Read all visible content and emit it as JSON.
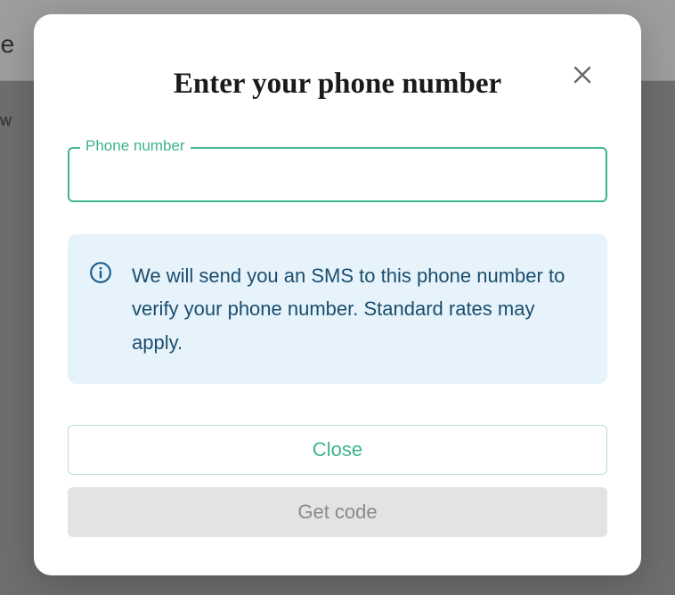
{
  "backdrop": {
    "text1": "ne",
    "text2": "tw"
  },
  "modal": {
    "title": "Enter your phone number",
    "input": {
      "label": "Phone number",
      "value": ""
    },
    "info": {
      "text": "We will send you an SMS to this phone number to verify your phone number. Standard rates may apply."
    },
    "buttons": {
      "close": "Close",
      "getCode": "Get code"
    }
  }
}
